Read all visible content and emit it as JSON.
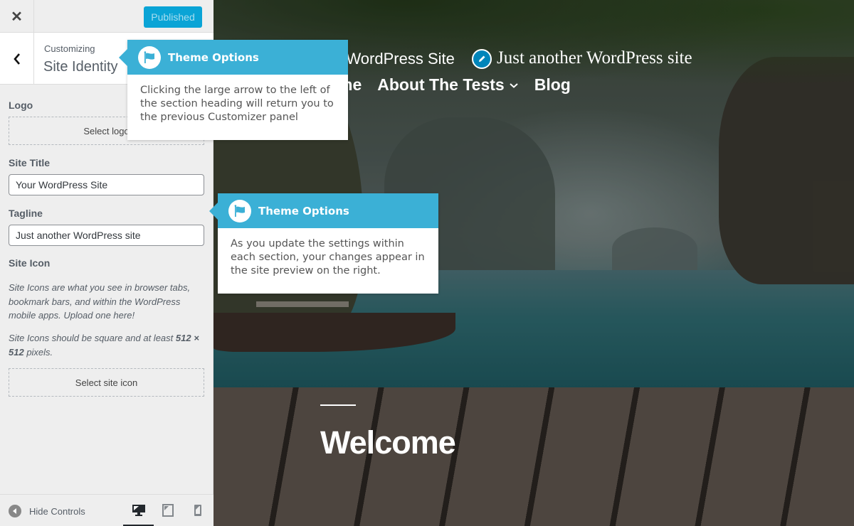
{
  "topbar": {
    "close_label": "✕",
    "publish_label": "Published"
  },
  "section": {
    "subtitle": "Customizing",
    "title": "Site Identity"
  },
  "controls": {
    "logo": {
      "label": "Logo",
      "button": "Select logo"
    },
    "site_title": {
      "label": "Site Title",
      "value": "Your WordPress Site"
    },
    "tagline": {
      "label": "Tagline",
      "value": "Just another WordPress site"
    },
    "site_icon": {
      "label": "Site Icon",
      "description_1": "Site Icons are what you see in browser tabs, bookmark bars, and within the WordPress mobile apps. Upload one here!",
      "description_2_prefix": "Site Icons should be square and at least ",
      "description_2_bold": "512 × 512",
      "description_2_suffix": " pixels.",
      "button": "Select site icon"
    }
  },
  "footer": {
    "hide_controls_label": "Hide Controls",
    "devices": [
      {
        "name": "desktop",
        "active": true
      },
      {
        "name": "tablet",
        "active": false
      },
      {
        "name": "mobile",
        "active": false
      }
    ]
  },
  "preview": {
    "site_title_visible": "r WordPress Site",
    "tagline": "Just another WordPress site",
    "nav": [
      {
        "label": "me"
      },
      {
        "label": "About The Tests",
        "has_submenu": true
      },
      {
        "label": "Blog"
      }
    ],
    "hero_heading": "Welcome"
  },
  "tooltips": [
    {
      "title": "Theme Options",
      "body": "Clicking the large arrow to the left of the section heading will return you to the previous Customizer panel"
    },
    {
      "title": "Theme Options",
      "body": "As you update the settings within each section, your changes appear in the site preview on the right."
    }
  ],
  "colors": {
    "accent": "#0aa4d6",
    "tooltip_header": "#3bb0d6",
    "edit_shortcut": "#0085ba"
  }
}
